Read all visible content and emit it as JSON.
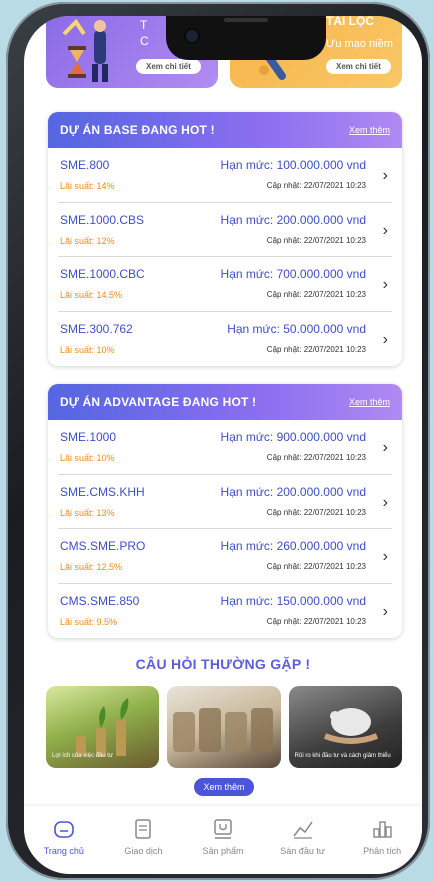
{
  "banners": [
    {
      "text": "Т",
      "sub": "C",
      "button": "Xem chi tiết"
    },
    {
      "text": "TÀI LỘC",
      "sub": "Ưu mạo niềm",
      "button": "Xem chi tiết"
    }
  ],
  "base_section": {
    "title": "DỰ ÁN BASE ĐANG HOT !",
    "more": "Xem thêm",
    "rows": [
      {
        "code": "SME.800",
        "rate": "Lãi suất: 14%",
        "limit": "Hạn mức: 100.000.000 vnd",
        "updated": "Cập nhật: 22/07/2021 10:23"
      },
      {
        "code": "SME.1000.CBS",
        "rate": "Lãi suất: 12%",
        "limit": "Hạn mức: 200.000.000 vnd",
        "updated": "Cập nhật: 22/07/2021 10:23"
      },
      {
        "code": "SME.1000.CBC",
        "rate": "Lãi suất: 14.5%",
        "limit": "Hạn mức: 700.000.000 vnd",
        "updated": "Cập nhật: 22/07/2021 10:23"
      },
      {
        "code": "SME.300.762",
        "rate": "Lãi suất: 10%",
        "limit": "Hạn mức: 50.000.000 vnd",
        "updated": "Cập nhật: 22/07/2021 10:23"
      }
    ]
  },
  "advantage_section": {
    "title": "DỰ ÁN ADVANTAGE ĐANG HOT !",
    "more": "Xem thêm",
    "rows": [
      {
        "code": "SME.1000",
        "rate": "Lãi suất: 10%",
        "limit": "Hạn mức: 900.000.000 vnd",
        "updated": "Cập nhật: 22/07/2021 10:23"
      },
      {
        "code": "SME.CMS.KHH",
        "rate": "Lãi suất: 13%",
        "limit": "Hạn mức: 200.000.000 vnd",
        "updated": "Cập nhật: 22/07/2021 10:23"
      },
      {
        "code": "CMS.SME.PRO",
        "rate": "Lãi suất: 12.5%",
        "limit": "Hạn mức: 260.000.000 vnd",
        "updated": "Cập nhật: 22/07/2021 10:23"
      },
      {
        "code": "CMS.SME.850",
        "rate": "Lãi suất: 9.5%",
        "limit": "Hạn mức: 150.000.000 vnd",
        "updated": "Cập nhật: 22/07/2021 10:23"
      }
    ]
  },
  "faq": {
    "title": "CÂU HỎI THƯỜNG GẶP !",
    "items": [
      {
        "caption": "Lợi ích của việc đầu tư"
      },
      {
        "caption": ""
      },
      {
        "caption": "Rủi ro khi đầu tư và cách giảm thiểu"
      }
    ],
    "more": "Xem thêm"
  },
  "tabs": [
    {
      "label": "Trang chủ",
      "icon": "home-icon",
      "active": true
    },
    {
      "label": "Giao dịch",
      "icon": "document-icon",
      "active": false
    },
    {
      "label": "Sản phẩm",
      "icon": "product-box-icon",
      "active": false
    },
    {
      "label": "Sàn đầu tư",
      "icon": "chart-line-icon",
      "active": false
    },
    {
      "label": "Phân tích",
      "icon": "analytics-icon",
      "active": false
    }
  ],
  "colors": {
    "accent": "#4b55d8",
    "rate": "#f28b1a",
    "code": "#3e4fc9"
  }
}
